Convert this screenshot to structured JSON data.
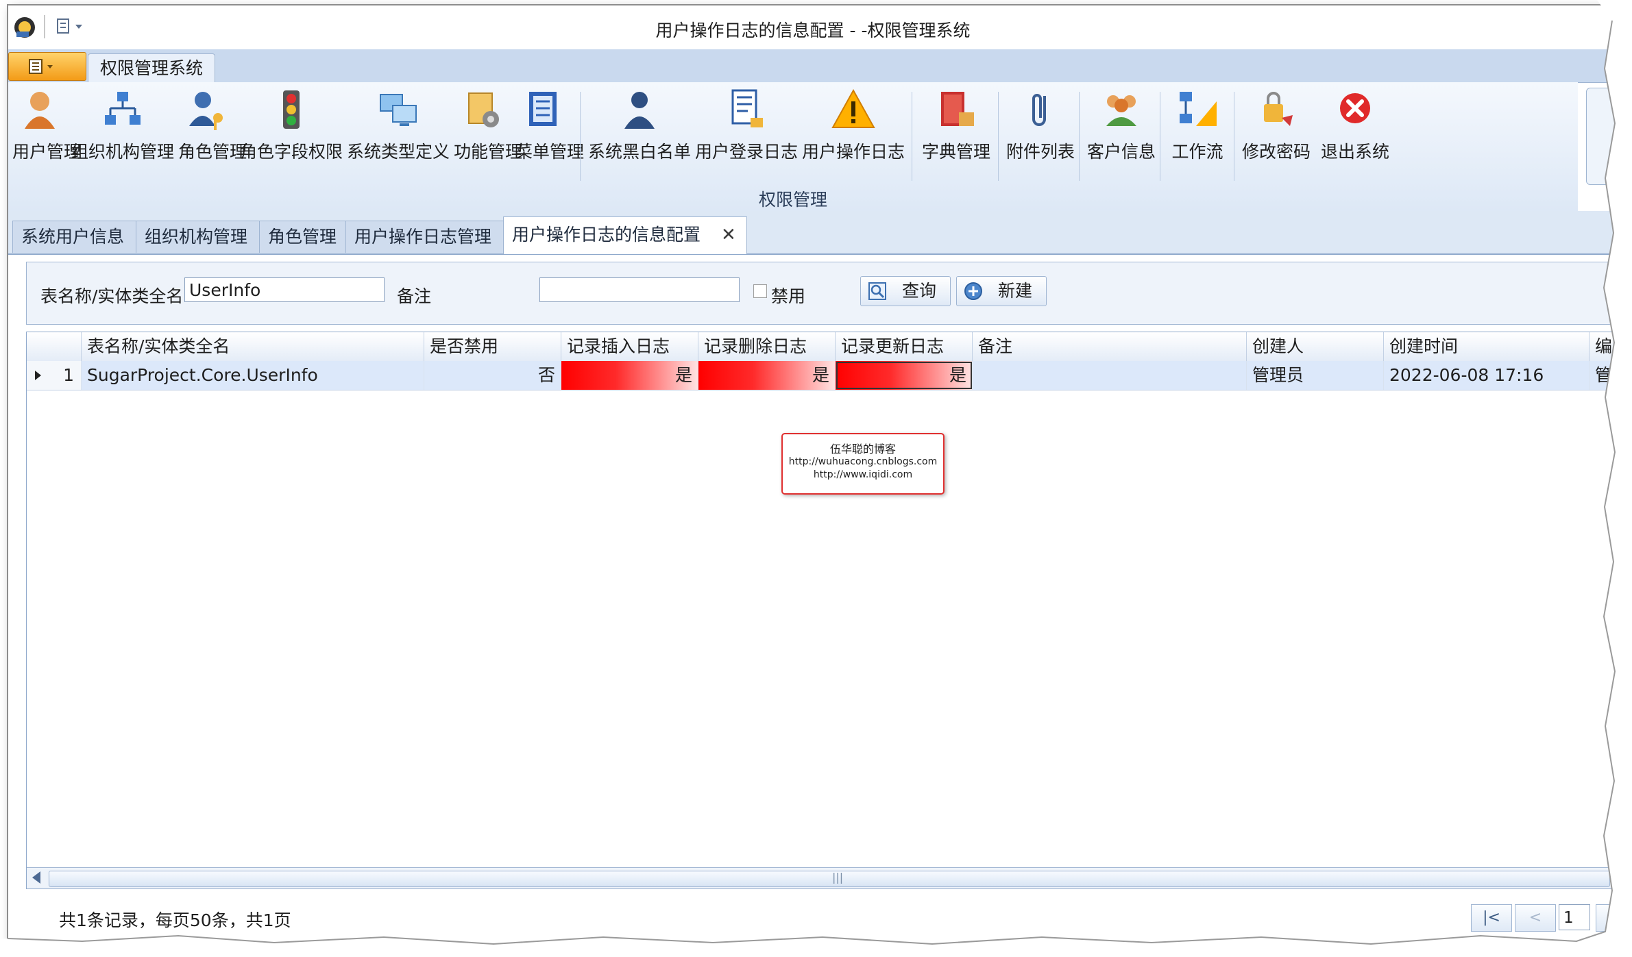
{
  "window": {
    "title": "用户操作日志的信息配置 - -权限管理系统"
  },
  "ribbon": {
    "tab": "权限管理系统",
    "group_label": "权限管理",
    "buttons": [
      {
        "label": "用户管理",
        "icon": "user-icon"
      },
      {
        "label": "组织机构管理",
        "icon": "org-chart-icon"
      },
      {
        "label": "角色管理",
        "icon": "role-key-icon"
      },
      {
        "label": "角色字段权限",
        "icon": "traffic-light-icon"
      },
      {
        "label": "系统类型定义",
        "icon": "computers-icon"
      },
      {
        "label": "功能管理",
        "icon": "function-gear-icon"
      },
      {
        "label": "菜单管理",
        "icon": "menu-book-icon"
      },
      {
        "label": "系统黑白名单",
        "icon": "person-icon"
      },
      {
        "label": "用户登录日志",
        "icon": "log-lock-icon"
      },
      {
        "label": "用户操作日志",
        "icon": "warning-icon"
      },
      {
        "label": "字典管理",
        "icon": "dictionary-icon"
      },
      {
        "label": "附件列表",
        "icon": "paperclip-icon"
      },
      {
        "label": "客户信息",
        "icon": "customers-icon"
      },
      {
        "label": "工作流",
        "icon": "workflow-icon"
      },
      {
        "label": "修改密码",
        "icon": "password-key-icon"
      },
      {
        "label": "退出系统",
        "icon": "exit-icon"
      }
    ]
  },
  "doc_tabs": [
    {
      "label": "系统用户信息"
    },
    {
      "label": "组织机构管理"
    },
    {
      "label": "角色管理"
    },
    {
      "label": "用户操作日志管理"
    },
    {
      "label": "用户操作日志的信息配置",
      "active": true
    }
  ],
  "search": {
    "table_label": "表名称/实体类全名",
    "table_value": "UserInfo",
    "remark_label": "备注",
    "remark_value": "",
    "disabled_label": "禁用",
    "query_button": "查询",
    "new_button": "新建"
  },
  "grid": {
    "columns": [
      "表名称/实体类全名",
      "是否禁用",
      "记录插入日志",
      "记录删除日志",
      "记录更新日志",
      "备注",
      "创建人",
      "创建时间",
      "编"
    ],
    "rows": [
      {
        "index": "1",
        "table_name": "SugarProject.Core.UserInfo",
        "disabled": "否",
        "insert_log": "是",
        "delete_log": "是",
        "update_log": "是",
        "remark": "",
        "creator": "管理员",
        "created_time": "2022-06-08 17:16",
        "editor_cut": "管"
      }
    ]
  },
  "pager": {
    "summary": "共1条记录，每页50条，共1页",
    "first": "|<",
    "prev": "<",
    "page": "1"
  },
  "watermark": {
    "title": "伍华聪的博客",
    "line1": "http://wuhuacong.cnblogs.com",
    "line2": "http://www.iqidi.com"
  },
  "colors": {
    "ribbon_bg": "#dde8f6",
    "highlight_red": "#ff0000",
    "selected_row": "#dce8fa",
    "border_blue": "#9fb5d2"
  }
}
